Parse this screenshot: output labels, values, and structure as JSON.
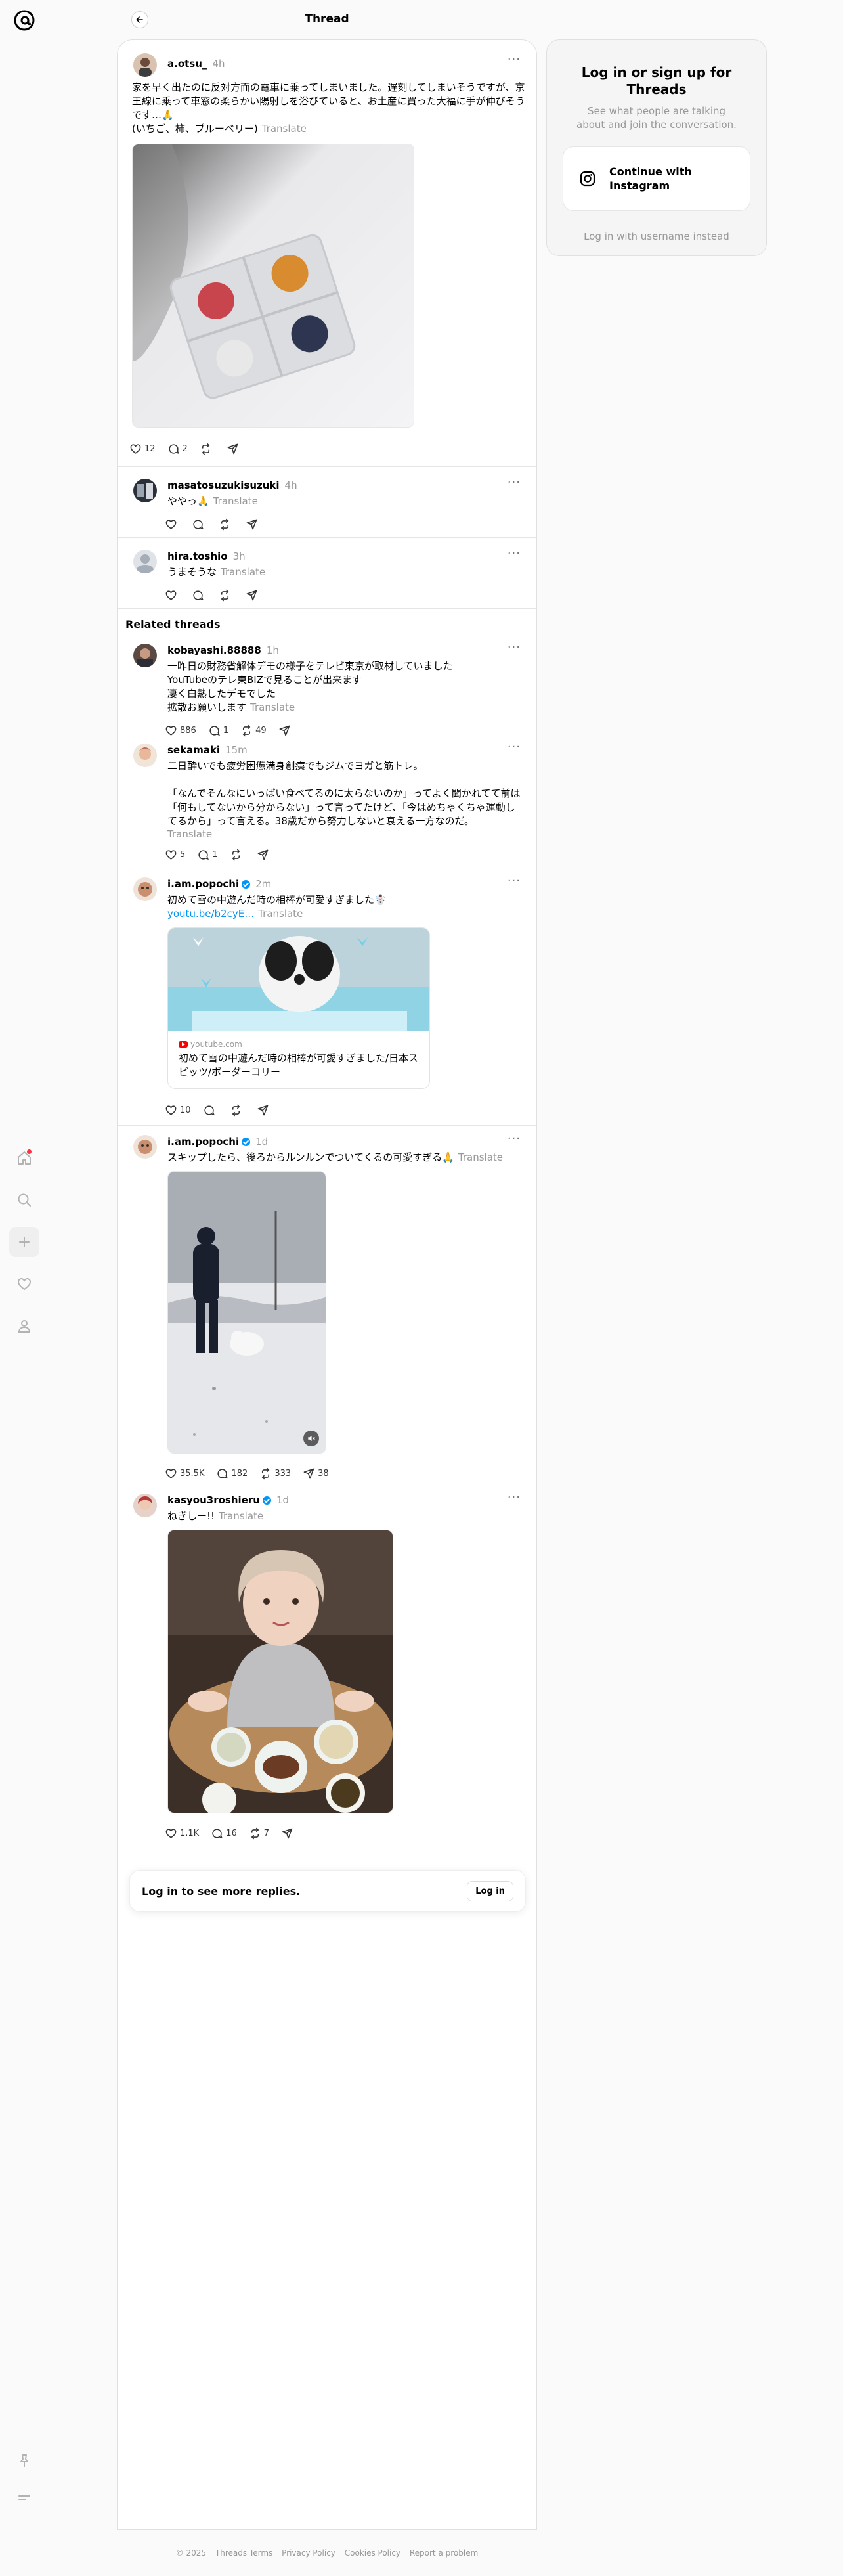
{
  "header": {
    "title": "Thread"
  },
  "main_post": {
    "username": "a.otsu_",
    "time": "4h",
    "text": "家を早く出たのに反対方面の電車に乗ってしまいました。遅刻してしまいそうですが、京王線に乗って車窓の柔らかい陽射しを浴びていると、お土産に買った大福に手が伸びそうです…🙏\n(いちご、柿、ブルーベリー)",
    "translate": "Translate",
    "likes": "12",
    "replies": "2"
  },
  "replies": [
    {
      "username": "masatosuzukisuzuki",
      "time": "4h",
      "text": "ややっ🙏",
      "translate": "Translate"
    },
    {
      "username": "hira.toshio",
      "time": "3h",
      "text": "うまそうな",
      "translate": "Translate"
    }
  ],
  "related": {
    "title": "Related threads",
    "posts": [
      {
        "username": "kobayashi.88888",
        "time": "1h",
        "text": "一昨日の財務省解体デモの様子をテレビ東京が取材していました\nYouTubeのテレ東BIZで見ることが出来ます\n凄く白熱したデモでした\n拡散お願いします",
        "translate": "Translate",
        "likes": "886",
        "replies": "1",
        "reposts": "49"
      },
      {
        "username": "sekamaki",
        "time": "15m",
        "text": "二日酔いでも疲労困憊満身創痍でもジムでヨガと筋トレ。\n\n「なんでそんなにいっぱい食べてるのに太らないのか」ってよく聞かれてて前は「何もしてないから分からない」って言ってたけど、「今はめちゃくちゃ運動してるから」って言える。38歳だから努力しないと衰える一方なのだ。",
        "translate": "Translate",
        "likes": "5",
        "replies": "1"
      },
      {
        "username": "i.am.popochi",
        "time": "2m",
        "text": "初めて雪の中遊んだ時の相棒が可愛すぎました☃️",
        "link": "youtu.be/b2cyE…",
        "translate": "Translate",
        "card_domain": "youtube.com",
        "card_title": "初めて雪の中遊んだ時の相棒が可愛すぎました/日本スピッツ/ボーダーコリー",
        "likes": "10"
      },
      {
        "username": "i.am.popochi",
        "time": "1d",
        "text": "スキップしたら、後ろからルンルンでついてくるの可愛すぎる🙏",
        "translate": "Translate",
        "likes": "35.5K",
        "replies": "182",
        "reposts": "333",
        "shares": "38"
      },
      {
        "username": "kasyou3roshieru",
        "time": "1d",
        "text": "ねぎしー!!",
        "translate": "Translate",
        "likes": "1.1K",
        "replies": "16",
        "reposts": "7"
      }
    ]
  },
  "login_replies": {
    "text": "Log in to see more replies.",
    "button": "Log in"
  },
  "side": {
    "title": "Log in or sign up for Threads",
    "subtitle": "See what people are talking about and join the conversation.",
    "instagram_button": "Continue with Instagram",
    "alt_login": "Log in with username instead"
  },
  "footer": {
    "copyright": "© 2025",
    "terms": "Threads Terms",
    "privacy": "Privacy Policy",
    "cookies": "Cookies Policy",
    "report": "Report a problem"
  },
  "colors": {
    "accent": "#0095f6",
    "notification": "#ff3040",
    "muted": "#999999"
  }
}
